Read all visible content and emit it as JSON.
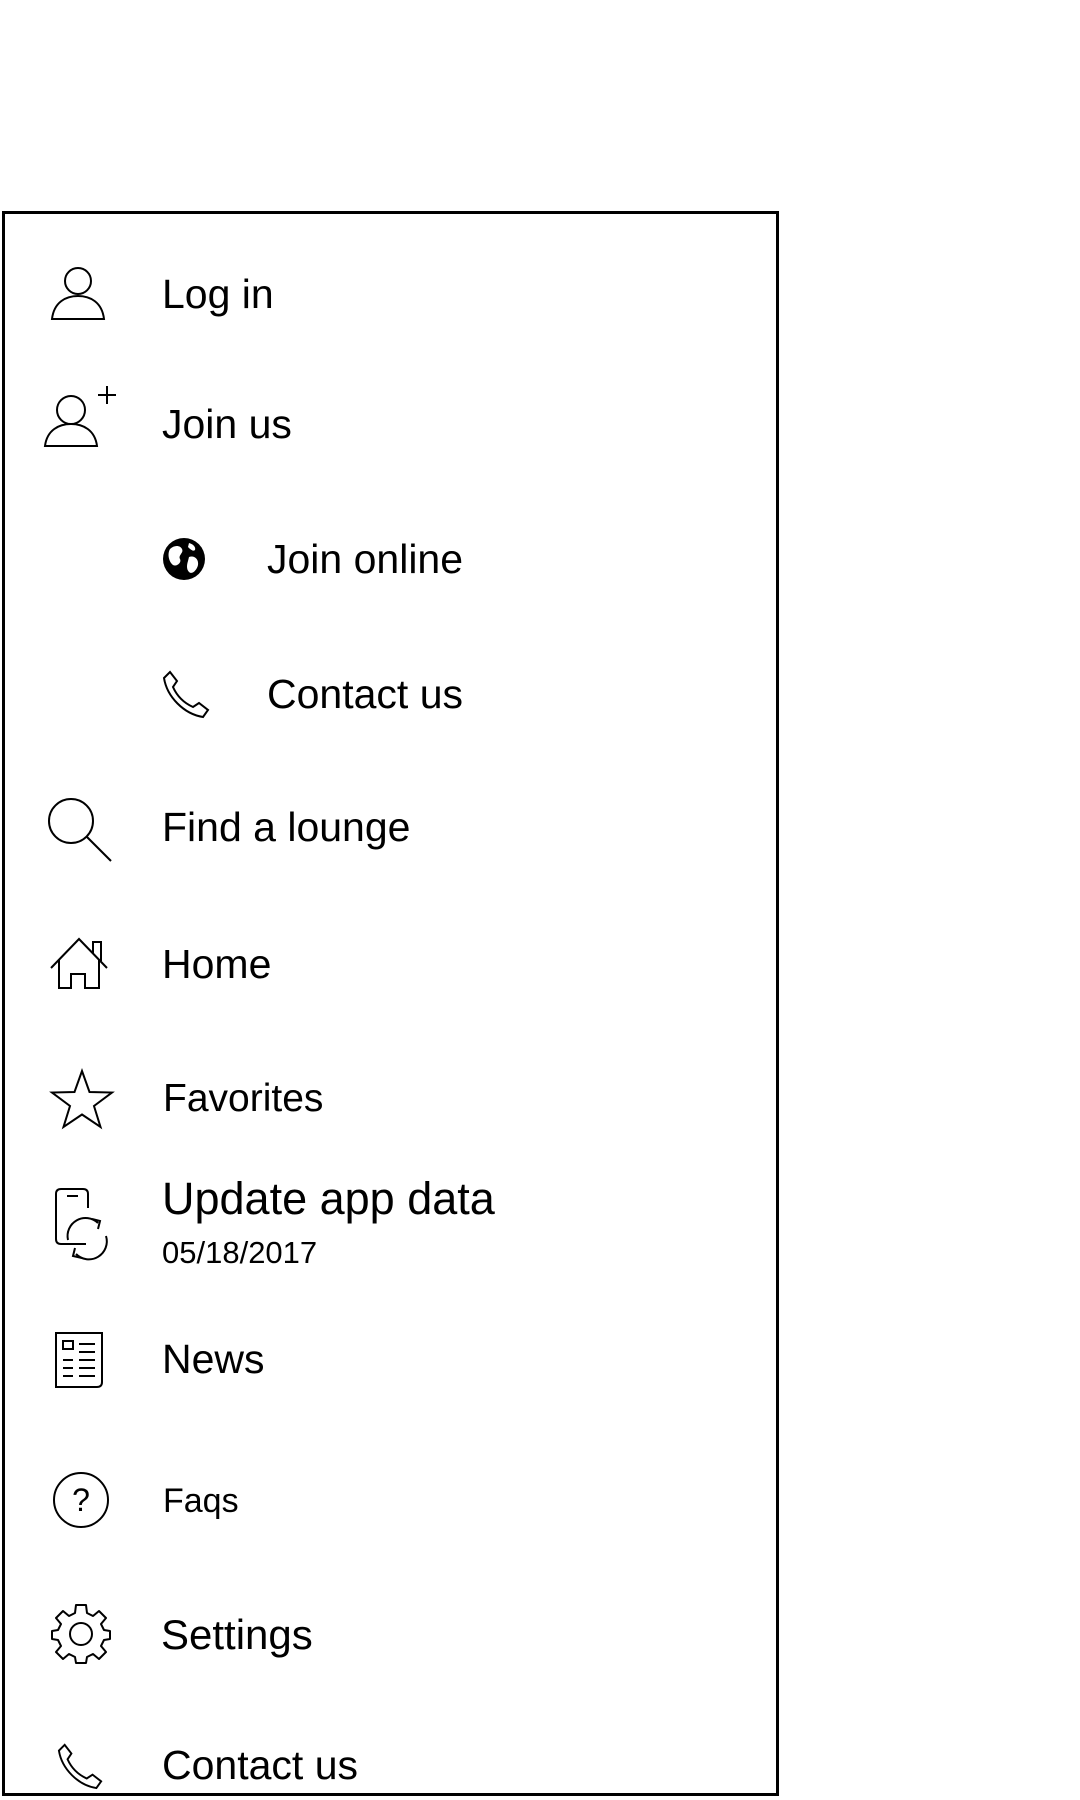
{
  "menu": {
    "items": [
      {
        "key": "log-in",
        "label": "Log in",
        "icon": "user-icon"
      },
      {
        "key": "join-us",
        "label": "Join us",
        "icon": "user-plus-icon"
      },
      {
        "key": "join-online",
        "label": "Join online",
        "icon": "globe-icon"
      },
      {
        "key": "contact-us-sub",
        "label": "Contact us",
        "icon": "phone-icon"
      },
      {
        "key": "find-lounge",
        "label": "Find a lounge",
        "icon": "search-icon"
      },
      {
        "key": "home",
        "label": "Home",
        "icon": "home-icon"
      },
      {
        "key": "favorites",
        "label": "Favorites",
        "icon": "star-icon"
      },
      {
        "key": "update-app-data",
        "label": "Update app data",
        "sublabel": "05/18/2017",
        "icon": "phone-sync-icon"
      },
      {
        "key": "news",
        "label": "News",
        "icon": "newspaper-icon"
      },
      {
        "key": "faqs",
        "label": "Faqs",
        "icon": "help-circle-icon"
      },
      {
        "key": "settings",
        "label": "Settings",
        "icon": "gear-icon"
      },
      {
        "key": "contact-us",
        "label": "Contact us",
        "icon": "phone-icon"
      }
    ]
  },
  "colors": {
    "background": "#ffffff",
    "foreground": "#000000"
  }
}
